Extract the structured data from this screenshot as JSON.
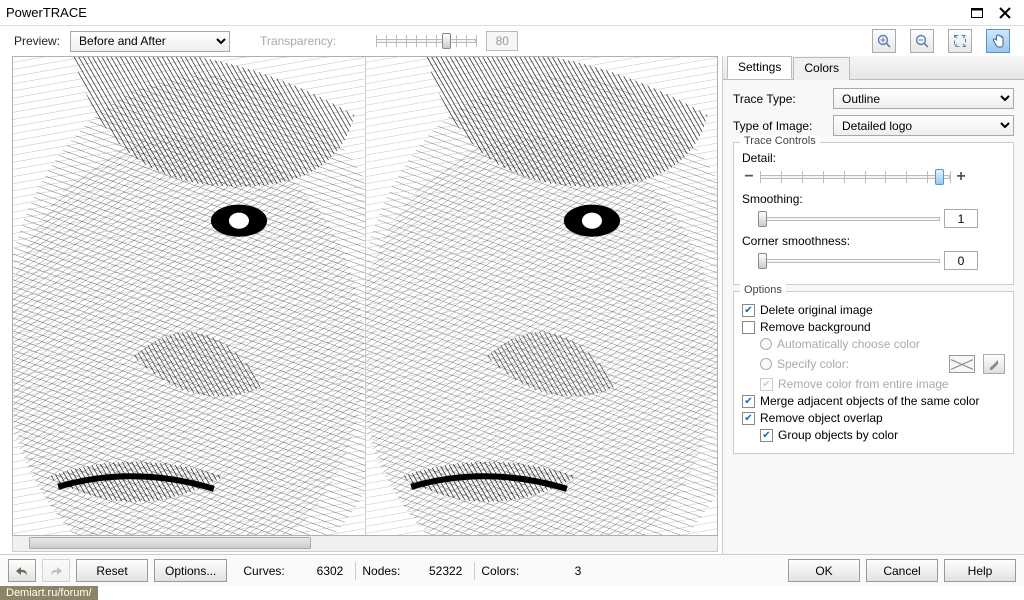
{
  "window": {
    "title": "PowerTRACE"
  },
  "toolbar": {
    "preview_label": "Preview:",
    "preview_value": "Before and After",
    "transparency_label": "Transparency:",
    "transparency_value": "80"
  },
  "tabs": {
    "settings": "Settings",
    "colors": "Colors"
  },
  "settings": {
    "trace_type_label": "Trace Type:",
    "trace_type_value": "Outline",
    "type_of_image_label": "Type of Image:",
    "type_of_image_value": "Detailed logo",
    "trace_controls_legend": "Trace Controls",
    "detail_label": "Detail:",
    "smoothing_label": "Smoothing:",
    "smoothing_value": "1",
    "corner_label": "Corner smoothness:",
    "corner_value": "0",
    "options_legend": "Options",
    "delete_original": "Delete original image",
    "remove_background": "Remove background",
    "auto_color": "Automatically choose color",
    "specify_color": "Specify color:",
    "remove_color_entire": "Remove color from entire image",
    "merge_adjacent": "Merge adjacent objects of the same color",
    "remove_overlap": "Remove object overlap",
    "group_by_color": "Group objects by color"
  },
  "statusbar": {
    "reset": "Reset",
    "options": "Options...",
    "curves_label": "Curves:",
    "curves_value": "6302",
    "nodes_label": "Nodes:",
    "nodes_value": "52322",
    "colors_label": "Colors:",
    "colors_value": "3",
    "ok": "OK",
    "cancel": "Cancel",
    "help": "Help"
  },
  "watermark": "Demiart.ru/forum/"
}
